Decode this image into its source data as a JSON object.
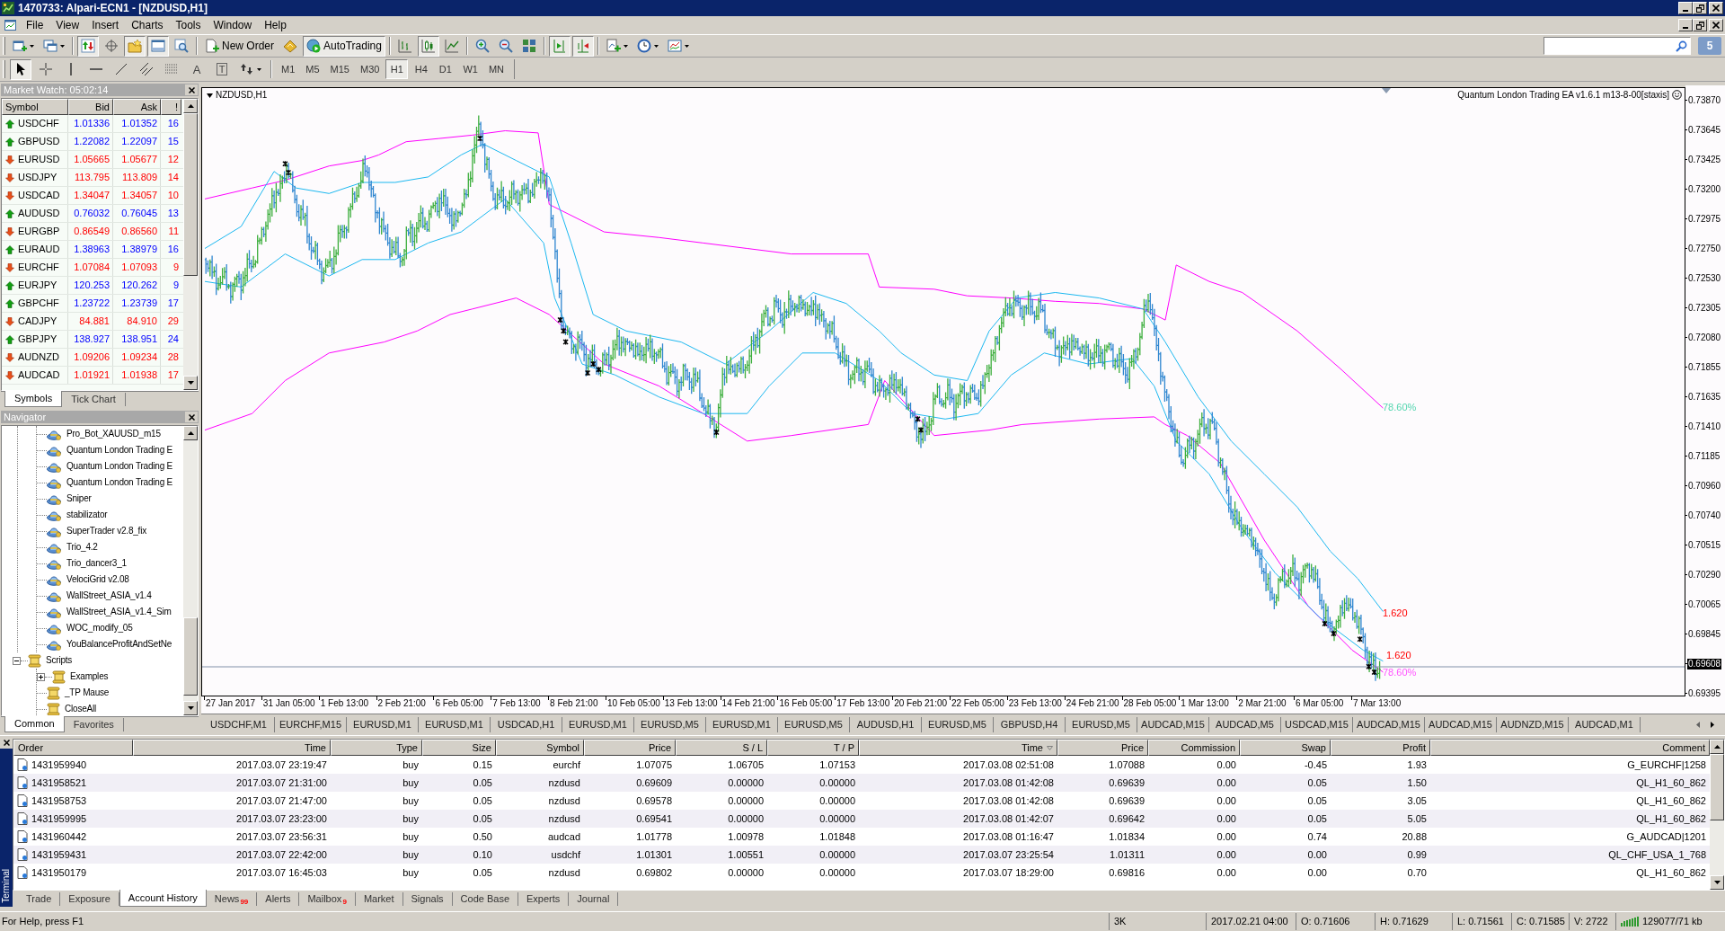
{
  "window": {
    "title": "1470733: Alpari-ECN1 - [NZDUSD,H1]"
  },
  "menu": [
    "File",
    "View",
    "Insert",
    "Charts",
    "Tools",
    "Window",
    "Help"
  ],
  "toolbar": [
    {
      "kind": "new-chart",
      "pressed": false,
      "dropdown": true
    },
    {
      "kind": "profiles",
      "pressed": false,
      "dropdown": true
    },
    {
      "kind": "sep"
    },
    {
      "kind": "market-watch",
      "pressed": true
    },
    {
      "kind": "data-window",
      "pressed": false
    },
    {
      "kind": "navigator",
      "pressed": true
    },
    {
      "kind": "terminal",
      "pressed": true
    },
    {
      "kind": "tester",
      "pressed": false
    },
    {
      "kind": "sep"
    },
    {
      "kind": "new-order",
      "label": "New Order",
      "pressed": false
    },
    {
      "kind": "editor",
      "pressed": false
    },
    {
      "kind": "autotrading",
      "label": "AutoTrading",
      "pressed": true
    },
    {
      "kind": "sep"
    },
    {
      "kind": "bar-chart",
      "pressed": false
    },
    {
      "kind": "candles",
      "pressed": true
    },
    {
      "kind": "line-chart",
      "pressed": false
    },
    {
      "kind": "sep"
    },
    {
      "kind": "zoom-in",
      "pressed": false
    },
    {
      "kind": "zoom-out",
      "pressed": false
    },
    {
      "kind": "tile",
      "pressed": false
    },
    {
      "kind": "sep"
    },
    {
      "kind": "shift",
      "pressed": true
    },
    {
      "kind": "autoscroll",
      "pressed": true
    },
    {
      "kind": "sep"
    },
    {
      "kind": "indicators",
      "pressed": false,
      "dropdown": true
    },
    {
      "kind": "periods",
      "pressed": false,
      "dropdown": true
    },
    {
      "kind": "templates",
      "pressed": false,
      "dropdown": true
    }
  ],
  "drawing_tools": [
    {
      "kind": "cursor",
      "selected": true
    },
    {
      "kind": "crosshair",
      "selected": false
    },
    {
      "kind": "vline",
      "selected": false
    },
    {
      "kind": "hline",
      "selected": false
    },
    {
      "kind": "trendline",
      "selected": false
    },
    {
      "kind": "channel",
      "selected": false
    },
    {
      "kind": "fibo",
      "selected": false
    },
    {
      "kind": "text",
      "label": "A",
      "selected": false
    },
    {
      "kind": "text-label",
      "label": "T",
      "selected": false
    },
    {
      "kind": "arrows",
      "selected": false,
      "dropdown": true
    }
  ],
  "timeframes": [
    {
      "label": "M1",
      "selected": false
    },
    {
      "label": "M5",
      "selected": false
    },
    {
      "label": "M15",
      "selected": false
    },
    {
      "label": "M30",
      "selected": false
    },
    {
      "label": "H1",
      "selected": true
    },
    {
      "label": "H4",
      "selected": false
    },
    {
      "label": "D1",
      "selected": false
    },
    {
      "label": "W1",
      "selected": false
    },
    {
      "label": "MN",
      "selected": false
    }
  ],
  "messages": {
    "count": "5"
  },
  "market_watch": {
    "title": "Market Watch: 05:02:14",
    "columns": [
      "Symbol",
      "Bid",
      "Ask",
      "!"
    ],
    "rows": [
      {
        "symbol": "USDCHF",
        "rising": true,
        "bid": "1.01336",
        "ask": "1.01352",
        "spread": "16"
      },
      {
        "symbol": "GBPUSD",
        "rising": true,
        "bid": "1.22082",
        "ask": "1.22097",
        "spread": "15"
      },
      {
        "symbol": "EURUSD",
        "rising": false,
        "bid": "1.05665",
        "ask": "1.05677",
        "spread": "12"
      },
      {
        "symbol": "USDJPY",
        "rising": false,
        "bid": "113.795",
        "ask": "113.809",
        "spread": "14"
      },
      {
        "symbol": "USDCAD",
        "rising": false,
        "bid": "1.34047",
        "ask": "1.34057",
        "spread": "10"
      },
      {
        "symbol": "AUDUSD",
        "rising": true,
        "bid": "0.76032",
        "ask": "0.76045",
        "spread": "13"
      },
      {
        "symbol": "EURGBP",
        "rising": false,
        "bid": "0.86549",
        "ask": "0.86560",
        "spread": "11"
      },
      {
        "symbol": "EURAUD",
        "rising": true,
        "bid": "1.38963",
        "ask": "1.38979",
        "spread": "16"
      },
      {
        "symbol": "EURCHF",
        "rising": false,
        "bid": "1.07084",
        "ask": "1.07093",
        "spread": "9"
      },
      {
        "symbol": "EURJPY",
        "rising": true,
        "bid": "120.253",
        "ask": "120.262",
        "spread": "9"
      },
      {
        "symbol": "GBPCHF",
        "rising": true,
        "bid": "1.23722",
        "ask": "1.23739",
        "spread": "17"
      },
      {
        "symbol": "CADJPY",
        "rising": false,
        "bid": "84.881",
        "ask": "84.910",
        "spread": "29"
      },
      {
        "symbol": "GBPJPY",
        "rising": true,
        "bid": "138.927",
        "ask": "138.951",
        "spread": "24"
      },
      {
        "symbol": "AUDNZD",
        "rising": false,
        "bid": "1.09206",
        "ask": "1.09234",
        "spread": "28"
      },
      {
        "symbol": "AUDCAD",
        "rising": false,
        "bid": "1.01921",
        "ask": "1.01938",
        "spread": "17"
      }
    ],
    "tabs": [
      {
        "label": "Symbols",
        "selected": true
      },
      {
        "label": "Tick Chart",
        "selected": false
      }
    ]
  },
  "navigator": {
    "title": "Navigator",
    "tree": [
      {
        "children": [
          {
            "label": "Pro_Bot_XAUUSD_m15",
            "kind": "expert"
          },
          {
            "label": "Quantum London Trading E",
            "kind": "expert"
          },
          {
            "label": "Quantum London Trading E",
            "kind": "expert"
          },
          {
            "label": "Quantum London Trading E",
            "kind": "expert"
          },
          {
            "label": "Sniper",
            "kind": "expert"
          },
          {
            "label": "stabilizator",
            "kind": "expert"
          },
          {
            "label": "SuperTrader v2.8_fix",
            "kind": "expert"
          },
          {
            "label": "Trio_4.2",
            "kind": "expert"
          },
          {
            "label": "Trio_dancer3_1",
            "kind": "expert"
          },
          {
            "label": "VelociGrid v2.08",
            "kind": "expert"
          },
          {
            "label": "WallStreet_ASIA_v1.4",
            "kind": "expert"
          },
          {
            "label": "WallStreet_ASIA_v1.4_Sim",
            "kind": "expert"
          },
          {
            "label": "WOC_modify_05",
            "kind": "expert"
          },
          {
            "label": "YouBalanceProfitAndSetNe",
            "kind": "expert"
          }
        ]
      },
      {
        "label": "Scripts",
        "kind": "folder",
        "expanded": true,
        "children": [
          {
            "label": "Examples",
            "kind": "folder",
            "expanded": false
          },
          {
            "label": "_TP Mause",
            "kind": "script"
          },
          {
            "label": "CloseAll",
            "kind": "script"
          }
        ]
      }
    ],
    "tabs": [
      {
        "label": "Common",
        "selected": true
      },
      {
        "label": "Favorites",
        "selected": false
      }
    ]
  },
  "chart": {
    "symbol_label": "NZDUSD,H1",
    "ea_label": "Quantum London Trading EA v1.6.1 m13-8-00[staxis]",
    "annotations": [
      {
        "text": "78.60%",
        "color": "#55d6b0"
      },
      {
        "text": "1.620",
        "color": "#ff0000"
      },
      {
        "text": "1.620",
        "color": "#ff0000"
      },
      {
        "text": "78.60%",
        "color": "#ff55ff"
      }
    ],
    "price_labels": [
      {
        "text": "0.73870",
        "current": false
      },
      {
        "text": "0.73645",
        "current": false
      },
      {
        "text": "0.73425",
        "current": false
      },
      {
        "text": "0.73200",
        "current": false
      },
      {
        "text": "0.72975",
        "current": false
      },
      {
        "text": "0.72750",
        "current": false
      },
      {
        "text": "0.72530",
        "current": false
      },
      {
        "text": "0.72305",
        "current": false
      },
      {
        "text": "0.72080",
        "current": false
      },
      {
        "text": "0.71855",
        "current": false
      },
      {
        "text": "0.71635",
        "current": false
      },
      {
        "text": "0.71410",
        "current": false
      },
      {
        "text": "0.71185",
        "current": false
      },
      {
        "text": "0.70960",
        "current": false
      },
      {
        "text": "0.70740",
        "current": false
      },
      {
        "text": "0.70515",
        "current": false
      },
      {
        "text": "0.70290",
        "current": false
      },
      {
        "text": "0.70065",
        "current": false
      },
      {
        "text": "0.69845",
        "current": false
      },
      {
        "text": "0.69608",
        "current": true
      },
      {
        "text": "0.69395",
        "current": false
      }
    ],
    "time_labels": [
      "27 Jan 2017",
      "31 Jan 05:00",
      "1 Feb 13:00",
      "2 Feb 21:00",
      "6 Feb 05:00",
      "7 Feb 13:00",
      "8 Feb 21:00",
      "10 Feb 05:00",
      "13 Feb 13:00",
      "14 Feb 21:00",
      "16 Feb 05:00",
      "17 Feb 13:00",
      "20 Feb 21:00",
      "22 Feb 05:00",
      "23 Feb 13:00",
      "24 Feb 21:00",
      "28 Feb 05:00",
      "1 Mar 13:00",
      "2 Mar 21:00",
      "6 Mar 05:00",
      "7 Mar 13:00"
    ]
  },
  "chart_tabs": [
    "USDCHF,M1",
    "EURCHF,M15",
    "EURUSD,M1",
    "EURUSD,M1",
    "USDCAD,H1",
    "EURUSD,M1",
    "EURUSD,M5",
    "EURUSD,M1",
    "EURUSD,M5",
    "AUDUSD,H1",
    "EURUSD,M5",
    "GBPUSD,H4",
    "EURUSD,M5",
    "AUDCAD,M15",
    "AUDCAD,M5",
    "USDCAD,M15",
    "AUDCAD,M15",
    "AUDCAD,M15",
    "AUDNZD,M15",
    "AUDCAD,M1"
  ],
  "terminal": {
    "label": "Terminal",
    "columns": [
      {
        "label": "Order",
        "sorted": false
      },
      {
        "label": "Time",
        "sorted": false
      },
      {
        "label": "Type",
        "sorted": false
      },
      {
        "label": "Size",
        "sorted": false
      },
      {
        "label": "Symbol",
        "sorted": false
      },
      {
        "label": "Price",
        "sorted": false
      },
      {
        "label": "S / L",
        "sorted": false
      },
      {
        "label": "T / P",
        "sorted": false
      },
      {
        "label": "Time",
        "sorted": true
      },
      {
        "label": "Price",
        "sorted": false
      },
      {
        "label": "Commission",
        "sorted": false
      },
      {
        "label": "Swap",
        "sorted": false
      },
      {
        "label": "Profit",
        "sorted": false
      },
      {
        "label": "Comment",
        "sorted": false
      }
    ],
    "rows": [
      {
        "cells": [
          "1431959940",
          "2017.03.07 23:19:47",
          "buy",
          "0.15",
          "eurchf",
          "1.07075",
          "1.06705",
          "1.07153",
          "2017.03.08 02:51:08",
          "1.07088",
          "0.00",
          "-0.45",
          "1.93",
          "G_EURCHF|1258"
        ]
      },
      {
        "cells": [
          "1431958521",
          "2017.03.07 21:31:00",
          "buy",
          "0.05",
          "nzdusd",
          "0.69609",
          "0.00000",
          "0.00000",
          "2017.03.08 01:42:08",
          "0.69639",
          "0.00",
          "0.05",
          "1.50",
          "QL_H1_60_862"
        ]
      },
      {
        "cells": [
          "1431958753",
          "2017.03.07 21:47:00",
          "buy",
          "0.05",
          "nzdusd",
          "0.69578",
          "0.00000",
          "0.00000",
          "2017.03.08 01:42:08",
          "0.69639",
          "0.00",
          "0.05",
          "3.05",
          "QL_H1_60_862"
        ]
      },
      {
        "cells": [
          "1431959995",
          "2017.03.07 23:23:00",
          "buy",
          "0.05",
          "nzdusd",
          "0.69541",
          "0.00000",
          "0.00000",
          "2017.03.08 01:42:07",
          "0.69642",
          "0.00",
          "0.05",
          "5.05",
          "QL_H1_60_862"
        ]
      },
      {
        "cells": [
          "1431960442",
          "2017.03.07 23:56:31",
          "buy",
          "0.50",
          "audcad",
          "1.01778",
          "1.00978",
          "1.01848",
          "2017.03.08 01:16:47",
          "1.01834",
          "0.00",
          "0.74",
          "20.88",
          "G_AUDCAD|1201"
        ]
      },
      {
        "cells": [
          "1431959431",
          "2017.03.07 22:42:00",
          "buy",
          "0.10",
          "usdchf",
          "1.01301",
          "1.00551",
          "0.00000",
          "2017.03.07 23:25:54",
          "1.01311",
          "0.00",
          "0.00",
          "0.99",
          "QL_CHF_USA_1_768"
        ]
      },
      {
        "cells": [
          "1431950179",
          "2017.03.07 16:45:03",
          "buy",
          "0.05",
          "nzdusd",
          "0.69802",
          "0.00000",
          "0.00000",
          "2017.03.07 18:29:00",
          "0.69816",
          "0.00",
          "0.00",
          "0.70",
          "QL_H1_60_862"
        ]
      }
    ],
    "tabs": [
      {
        "label": "Trade",
        "selected": false
      },
      {
        "label": "Exposure",
        "selected": false
      },
      {
        "label": "Account History",
        "selected": true
      },
      {
        "label": "News",
        "badge": "99",
        "selected": false
      },
      {
        "label": "Alerts",
        "selected": false
      },
      {
        "label": "Mailbox",
        "badge": "9",
        "selected": false
      },
      {
        "label": "Market",
        "selected": false
      },
      {
        "label": "Signals",
        "selected": false
      },
      {
        "label": "Code Base",
        "selected": false
      },
      {
        "label": "Experts",
        "selected": false
      },
      {
        "label": "Journal",
        "selected": false
      }
    ]
  },
  "status_bar": {
    "help": "For Help, press F1",
    "fields": [
      "3K",
      "2017.02.21 04:00",
      "O: 0.71606",
      "H: 0.71629",
      "L: 0.71561",
      "C: 0.71585",
      "V: 2722"
    ],
    "traffic": "129077/71 kb"
  }
}
